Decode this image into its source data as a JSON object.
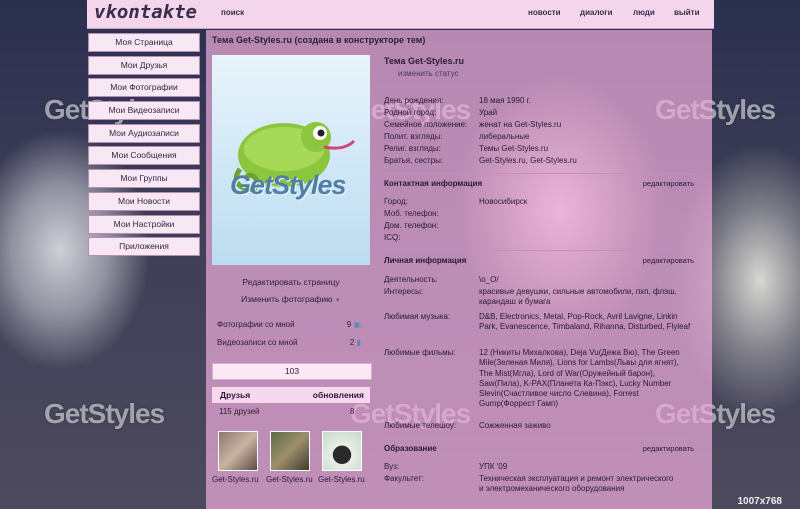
{
  "topbar": {
    "logo": "vkontakte",
    "search": "поиск",
    "links": [
      "новости",
      "диалоги",
      "люди",
      "выйти"
    ]
  },
  "menu": [
    "Моя Страница",
    "Мои Друзья",
    "Мои Фотографии",
    "Мои Видеозаписи",
    "Мои Аудиозаписи",
    "Мои Сообщения",
    "Мои Группы",
    "Мои Новости",
    "Мои Настройки",
    "Приложения"
  ],
  "main": {
    "title": "Тема Get-Styles.ru (создана в конструкторе тем)",
    "avatar_brand": "GetStyles",
    "edit_page": "Редактировать страницу",
    "edit_photo": "Изменить фотографию",
    "photos_with_me": "Фотографии со мной",
    "photos_count": "9",
    "videos_with_me": "Видеозаписи со мной",
    "videos_count": "2",
    "counter": "103",
    "friends": {
      "title": "Друзья",
      "updates": "обновления",
      "count_label": "115 друзей",
      "count_right": "8",
      "names": [
        "Get-Styles.ru",
        "Get-Styles.ru",
        "Get-Styles.ru"
      ]
    }
  },
  "profile": {
    "name": "Тема Get-Styles.ru",
    "status": "изменить статус",
    "basic": [
      {
        "label": "День рождения:",
        "value": "18 мая 1990 г."
      },
      {
        "label": "Родной город:",
        "value": "Урай"
      },
      {
        "label": "Семейное положение:",
        "value": "женат на  Get-Styles.ru"
      },
      {
        "label": "Полит. взгляды:",
        "value": "либеральные"
      },
      {
        "label": "Религ. взгляды:",
        "value": "Темы Get-Styles.ru"
      },
      {
        "label": "Братья, сестры:",
        "value": "Get-Styles.ru, Get-Styles.ru"
      }
    ],
    "contact_title": "Контактная информация",
    "edit": "редактировать",
    "contact": [
      {
        "label": "Город:",
        "value": "Новосибирск"
      },
      {
        "label": "Моб. телефон:",
        "value": ""
      },
      {
        "label": "Дом. телефон:",
        "value": ""
      },
      {
        "label": "ICQ:",
        "value": ""
      }
    ],
    "personal_title": "Личная информация",
    "activity_label": "Деятельность:",
    "activity": "\\о_О/",
    "interests_label": "Интересы:",
    "interests": "красивые девушки, сильные автомобили, пхп, флэш, карандаш и бумага",
    "music_label": "Любимая музыка:",
    "music": "D&B, Electronics, Metal, Pop-Rock, Avril Lavigne, Linkin Park, Evanescence, Timbaland, Rihanna, Disturbed, Flyleaf",
    "films_label": "Любимые фильмы:",
    "films": "12 (Никиты Михалкова), Deja Vu(Дежа Вю), The Green Mile(Зеленая Миля), Lions for Lambs(Львы для ягнят), The Mist(Мгла), Lord of War(Оружейный барон), Saw(Пила), K-PAX(Планета Ка-Пэкс), Lucky Number Slevin(Счастливое число Слевина), Forrest Gump(Форрест Гамп)",
    "tv_label": "Любимые телешоу:",
    "tv": "Сожженная заживо",
    "edu_title": "Образование",
    "vuz_label": "Вуз:",
    "vuz": "УПК '09",
    "faculty_label": "Факультет:",
    "faculty": "Техническая эксплуатация и ремонт электрического и электромеханического оборудования"
  },
  "watermark": {
    "text": "GetStyles",
    "sub": "www.get-styles.ru"
  },
  "resolution": "1007x768"
}
